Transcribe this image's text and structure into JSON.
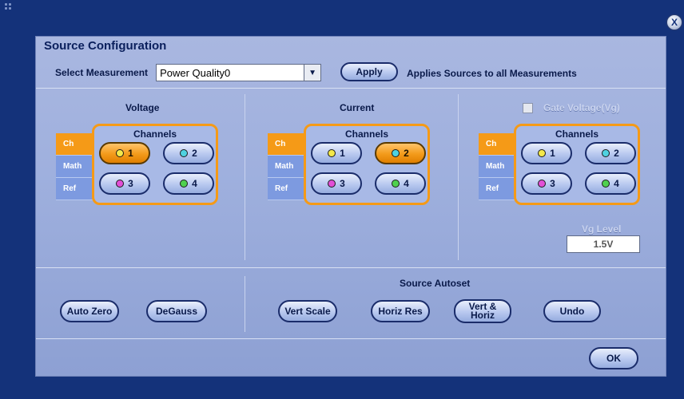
{
  "window": {
    "close_label": "X",
    "title": "Source Configuration"
  },
  "measurement": {
    "label": "Select Measurement",
    "selected": "Power Quality0",
    "dropdown_arrow": "▼",
    "apply_label": "Apply",
    "apply_note": "Applies Sources to all Measurements"
  },
  "tabs": {
    "ch": "Ch",
    "math": "Math",
    "ref": "Ref"
  },
  "channels_title": "Channels",
  "voltage": {
    "title": "Voltage",
    "selected_channel": "1"
  },
  "current": {
    "title": "Current",
    "selected_channel": "2"
  },
  "gate": {
    "title": "Gate Voltage(Vg)",
    "checked": false,
    "level_label": "Vg Level",
    "level_value": "1.5V"
  },
  "channels": [
    {
      "label": "1",
      "color": "#f4e84a"
    },
    {
      "label": "2",
      "color": "#4fd2e0"
    },
    {
      "label": "3",
      "color": "#e24fd6"
    },
    {
      "label": "4",
      "color": "#4fd14f"
    }
  ],
  "bottom": {
    "auto_zero": "Auto Zero",
    "degauss": "DeGauss",
    "autoset_title": "Source Autoset",
    "vert_scale": "Vert Scale",
    "horiz_res": "Horiz Res",
    "vert_horiz_line1": "Vert &",
    "vert_horiz_line2": "Horiz",
    "undo": "Undo",
    "ok": "OK"
  },
  "colors": {
    "accent_orange": "#f59a17",
    "tab_blue": "#7d9ae0",
    "background": "#14327a"
  }
}
